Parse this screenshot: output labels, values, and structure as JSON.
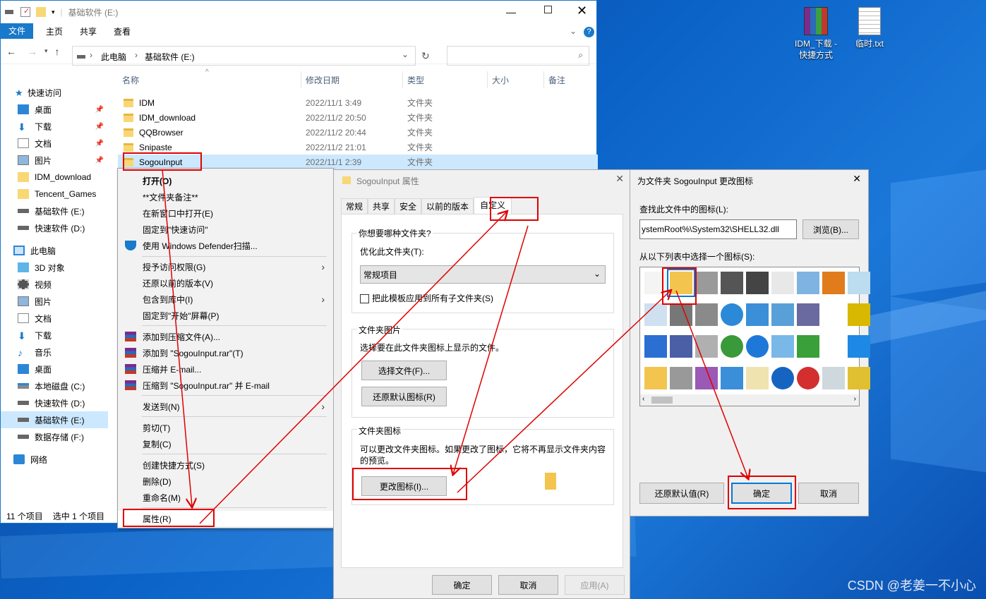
{
  "desktop": {
    "icons": [
      {
        "label_line1": "IDM_下载 -",
        "label_line2": "快捷方式"
      },
      {
        "label_line1": "临时.txt",
        "label_line2": ""
      }
    ],
    "watermark": "CSDN @老姜一不小心"
  },
  "explorer": {
    "title": "基础软件 (E:)",
    "ribbon_tabs": [
      "文件",
      "主页",
      "共享",
      "查看"
    ],
    "breadcrumb": [
      "此电脑",
      "基础软件 (E:)"
    ],
    "columns": [
      "名称",
      "修改日期",
      "类型",
      "大小",
      "备注"
    ],
    "nav_items": [
      {
        "label": "快速访问",
        "pinned": false
      },
      {
        "label": "桌面",
        "pinned": true
      },
      {
        "label": "下载",
        "pinned": true
      },
      {
        "label": "文档",
        "pinned": true
      },
      {
        "label": "图片",
        "pinned": true
      },
      {
        "label": "IDM_download",
        "pinned": false
      },
      {
        "label": "Tencent_Games",
        "pinned": false
      },
      {
        "label": "基础软件 (E:)",
        "pinned": false
      },
      {
        "label": "快速软件 (D:)",
        "pinned": false
      },
      {
        "label": "此电脑",
        "pinned": false
      },
      {
        "label": "3D 对象",
        "pinned": false
      },
      {
        "label": "视频",
        "pinned": false
      },
      {
        "label": "图片",
        "pinned": false
      },
      {
        "label": "文档",
        "pinned": false
      },
      {
        "label": "下载",
        "pinned": false
      },
      {
        "label": "音乐",
        "pinned": false
      },
      {
        "label": "桌面",
        "pinned": false
      },
      {
        "label": "本地磁盘 (C:)",
        "pinned": false
      },
      {
        "label": "快速软件 (D:)",
        "pinned": false
      },
      {
        "label": "基础软件 (E:)",
        "pinned": false
      },
      {
        "label": "数据存储 (F:)",
        "pinned": false
      },
      {
        "label": "网络",
        "pinned": false
      }
    ],
    "files": [
      {
        "name": "IDM",
        "date": "2022/11/1 3:49",
        "type": "文件夹"
      },
      {
        "name": "IDM_download",
        "date": "2022/11/2 20:50",
        "type": "文件夹"
      },
      {
        "name": "QQBrowser",
        "date": "2022/11/2 20:44",
        "type": "文件夹"
      },
      {
        "name": "Snipaste",
        "date": "2022/11/2 21:01",
        "type": "文件夹"
      },
      {
        "name": "SogouInput",
        "date": "2022/11/1 2:39",
        "type": "文件夹"
      }
    ],
    "status": {
      "count": "11 个项目",
      "selected": "选中 1 个项目"
    }
  },
  "context_menu": {
    "items": [
      {
        "label": "打开(O)",
        "bold": true
      },
      {
        "label": "**文件夹备注**"
      },
      {
        "label": "在新窗口中打开(E)"
      },
      {
        "label": "固定到\"快速访问\""
      },
      {
        "label": "使用 Windows Defender扫描..."
      },
      {
        "label": "授予访问权限(G)"
      },
      {
        "label": "还原以前的版本(V)"
      },
      {
        "label": "包含到库中(I)"
      },
      {
        "label": "固定到\"开始\"屏幕(P)"
      },
      {
        "label": "添加到压缩文件(A)..."
      },
      {
        "label": "添加到 \"SogouInput.rar\"(T)"
      },
      {
        "label": "压缩并 E-mail..."
      },
      {
        "label": "压缩到 \"SogouInput.rar\" 并 E-mail"
      },
      {
        "label": "发送到(N)"
      },
      {
        "label": "剪切(T)"
      },
      {
        "label": "复制(C)"
      },
      {
        "label": "创建快捷方式(S)"
      },
      {
        "label": "删除(D)"
      },
      {
        "label": "重命名(M)"
      },
      {
        "label": "属性(R)"
      }
    ]
  },
  "properties": {
    "title": "SogouInput 属性",
    "tabs": [
      "常规",
      "共享",
      "安全",
      "以前的版本",
      "自定义"
    ],
    "group1_title": "你想要哪种文件夹?",
    "optimize_label": "优化此文件夹(T):",
    "optimize_value": "常规项目",
    "apply_template": "把此模板应用到所有子文件夹(S)",
    "group2_title": "文件夹图片",
    "group2_desc": "选择要在此文件夹图标上显示的文件。",
    "choose_file": "选择文件(F)...",
    "restore_default_icon": "还原默认图标(R)",
    "group3_title": "文件夹图标",
    "group3_desc_line1": "可以更改文件夹图标。如果更改了图标，它将不再显示文件夹内容",
    "group3_desc_line2": "的预览。",
    "change_icon": "更改图标(I)...",
    "ok": "确定",
    "cancel": "取消",
    "apply": "应用(A)"
  },
  "change_icon": {
    "title": "为文件夹 SogouInput 更改图标",
    "find_label": "查找此文件中的图标(L):",
    "path_value": "ystemRoot%\\System32\\SHELL32.dll",
    "browse": "浏览(B)...",
    "list_label": "从以下列表中选择一个图标(S):",
    "restore_default": "还原默认值(R)",
    "ok": "确定",
    "cancel": "取消",
    "icons": [
      "blank-doc-icon",
      "folder-icon",
      "drive-icon",
      "chip-icon",
      "printer-icon",
      "clock-doc-icon",
      "window-icon",
      "hand-share-icon",
      "recycle-icon",
      "list-doc-icon",
      "server-icon",
      "network-drive-icon",
      "globe-icon",
      "network-pc-icon",
      "display-icon",
      "projector-icon",
      "",
      "battery-icon",
      "window-blue-icon",
      "floppy-icon",
      "broken-drive-icon",
      "mouse-icon",
      "network-icon",
      "magnifier-icon",
      "download-icon",
      "",
      "blue-icon",
      "folder-small-icon",
      "disk-drive-icon",
      "cd-drive-icon",
      "monitor-icon",
      "grid-icon",
      "help-icon",
      "power-icon",
      "recycle-full-icon",
      "battery2-icon"
    ]
  }
}
